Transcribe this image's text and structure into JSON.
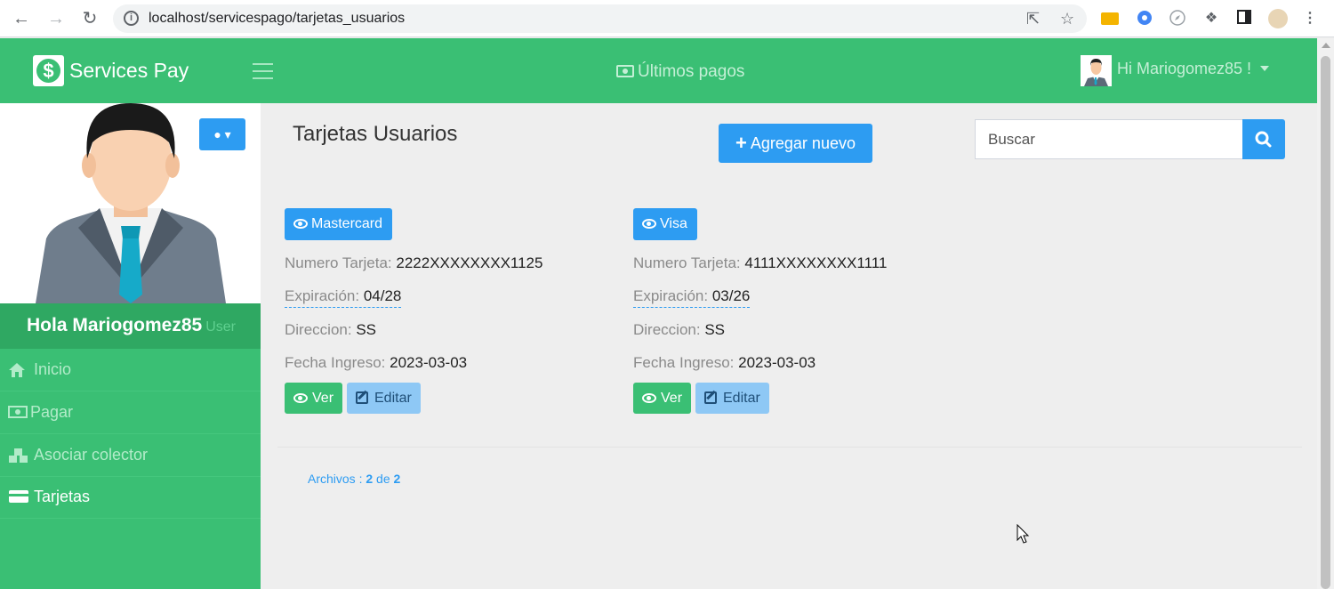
{
  "browser": {
    "url": "localhost/servicespago/tarjetas_usuarios"
  },
  "app": {
    "brand_name": "Services Pay",
    "top_center_label": "Últimos pagos",
    "greeting": "Hi Mariogomez85 !",
    "accent_color": "#3abf74",
    "primary_color": "#2d9cf2"
  },
  "sidebar": {
    "hola": "Hola Mariogomez85",
    "role": "User",
    "items": [
      {
        "label": "Inicio",
        "icon": "home-icon"
      },
      {
        "label": "Pagar",
        "icon": "money-icon"
      },
      {
        "label": "Asociar colector",
        "icon": "cubes-icon"
      },
      {
        "label": "Tarjetas",
        "icon": "credit-card-icon",
        "active": true
      }
    ]
  },
  "main": {
    "title": "Tarjetas Usuarios",
    "add_label": "Agregar nuevo",
    "search_placeholder": "Buscar",
    "cards": [
      {
        "brand": "Mastercard",
        "numero_label": "Numero Tarjeta:",
        "numero": "2222XXXXXXXX1125",
        "exp_label": "Expiración:",
        "exp": "04/28",
        "dir_label": "Direccion:",
        "dir": "SS",
        "fecha_label": "Fecha Ingreso:",
        "fecha": "2023-03-03",
        "ver_label": "Ver",
        "editar_label": "Editar"
      },
      {
        "brand": "Visa",
        "numero_label": "Numero Tarjeta:",
        "numero": "4111XXXXXXXX1111",
        "exp_label": "Expiración:",
        "exp": "03/26",
        "dir_label": "Direccion:",
        "dir": "SS",
        "fecha_label": "Fecha Ingreso:",
        "fecha": "2023-03-03",
        "ver_label": "Ver",
        "editar_label": "Editar"
      }
    ],
    "archivos_label": "Archivos :",
    "archivos_current": "2",
    "archivos_de": "de",
    "archivos_total": "2"
  }
}
